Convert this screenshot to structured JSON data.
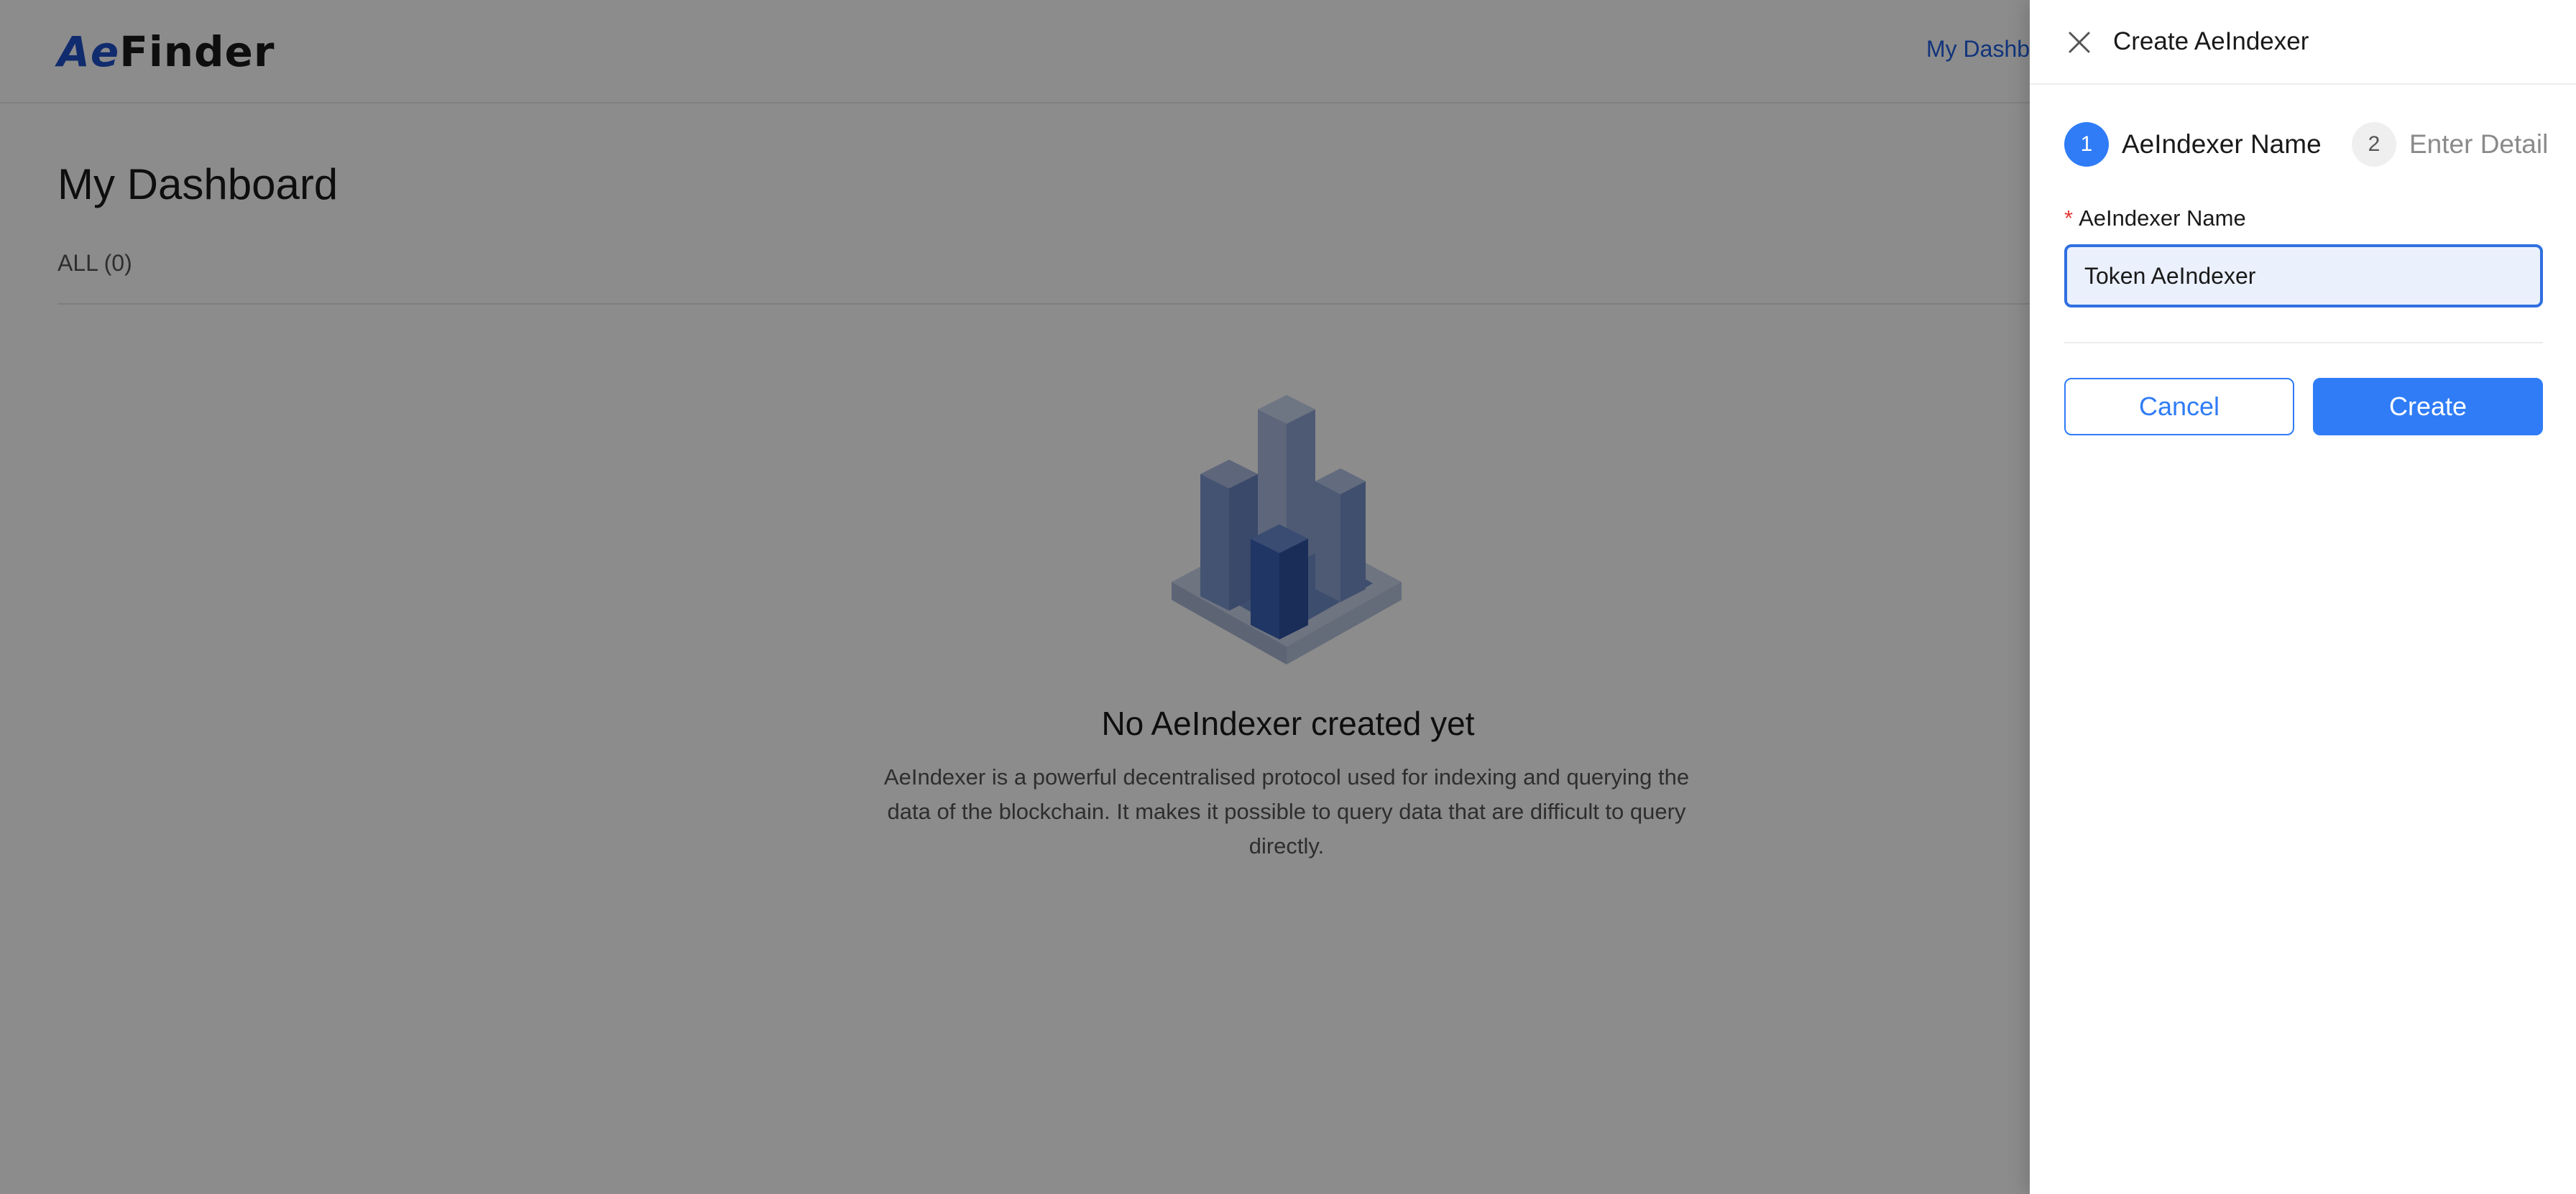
{
  "app": {
    "logo_prefix": "Ae",
    "logo_suffix": "Finder",
    "nav_link": "My Dashb"
  },
  "main": {
    "title": "My Dashboard",
    "tab_all": "ALL (0)",
    "empty_title": "No AeIndexer created yet",
    "empty_description": "AeIndexer is a powerful decentralised protocol used for indexing and querying the data of the blockchain. It makes it possible to query data that are difficult to query directly."
  },
  "drawer": {
    "title": "Create AeIndexer",
    "steps": [
      {
        "number": "1",
        "label": "AeIndexer Name",
        "state": "active"
      },
      {
        "number": "2",
        "label": "Enter Detail",
        "state": "inactive"
      }
    ],
    "field_required_mark": "*",
    "field_label": "AeIndexer Name",
    "field_value": "Token AeIndexer",
    "cancel_label": "Cancel",
    "create_label": "Create"
  },
  "colors": {
    "accent": "#2f7cf6",
    "nav_link": "#1f5fe0",
    "required": "#e53935"
  },
  "icons": {
    "close": "close-icon",
    "empty": "buildings-illustration"
  }
}
